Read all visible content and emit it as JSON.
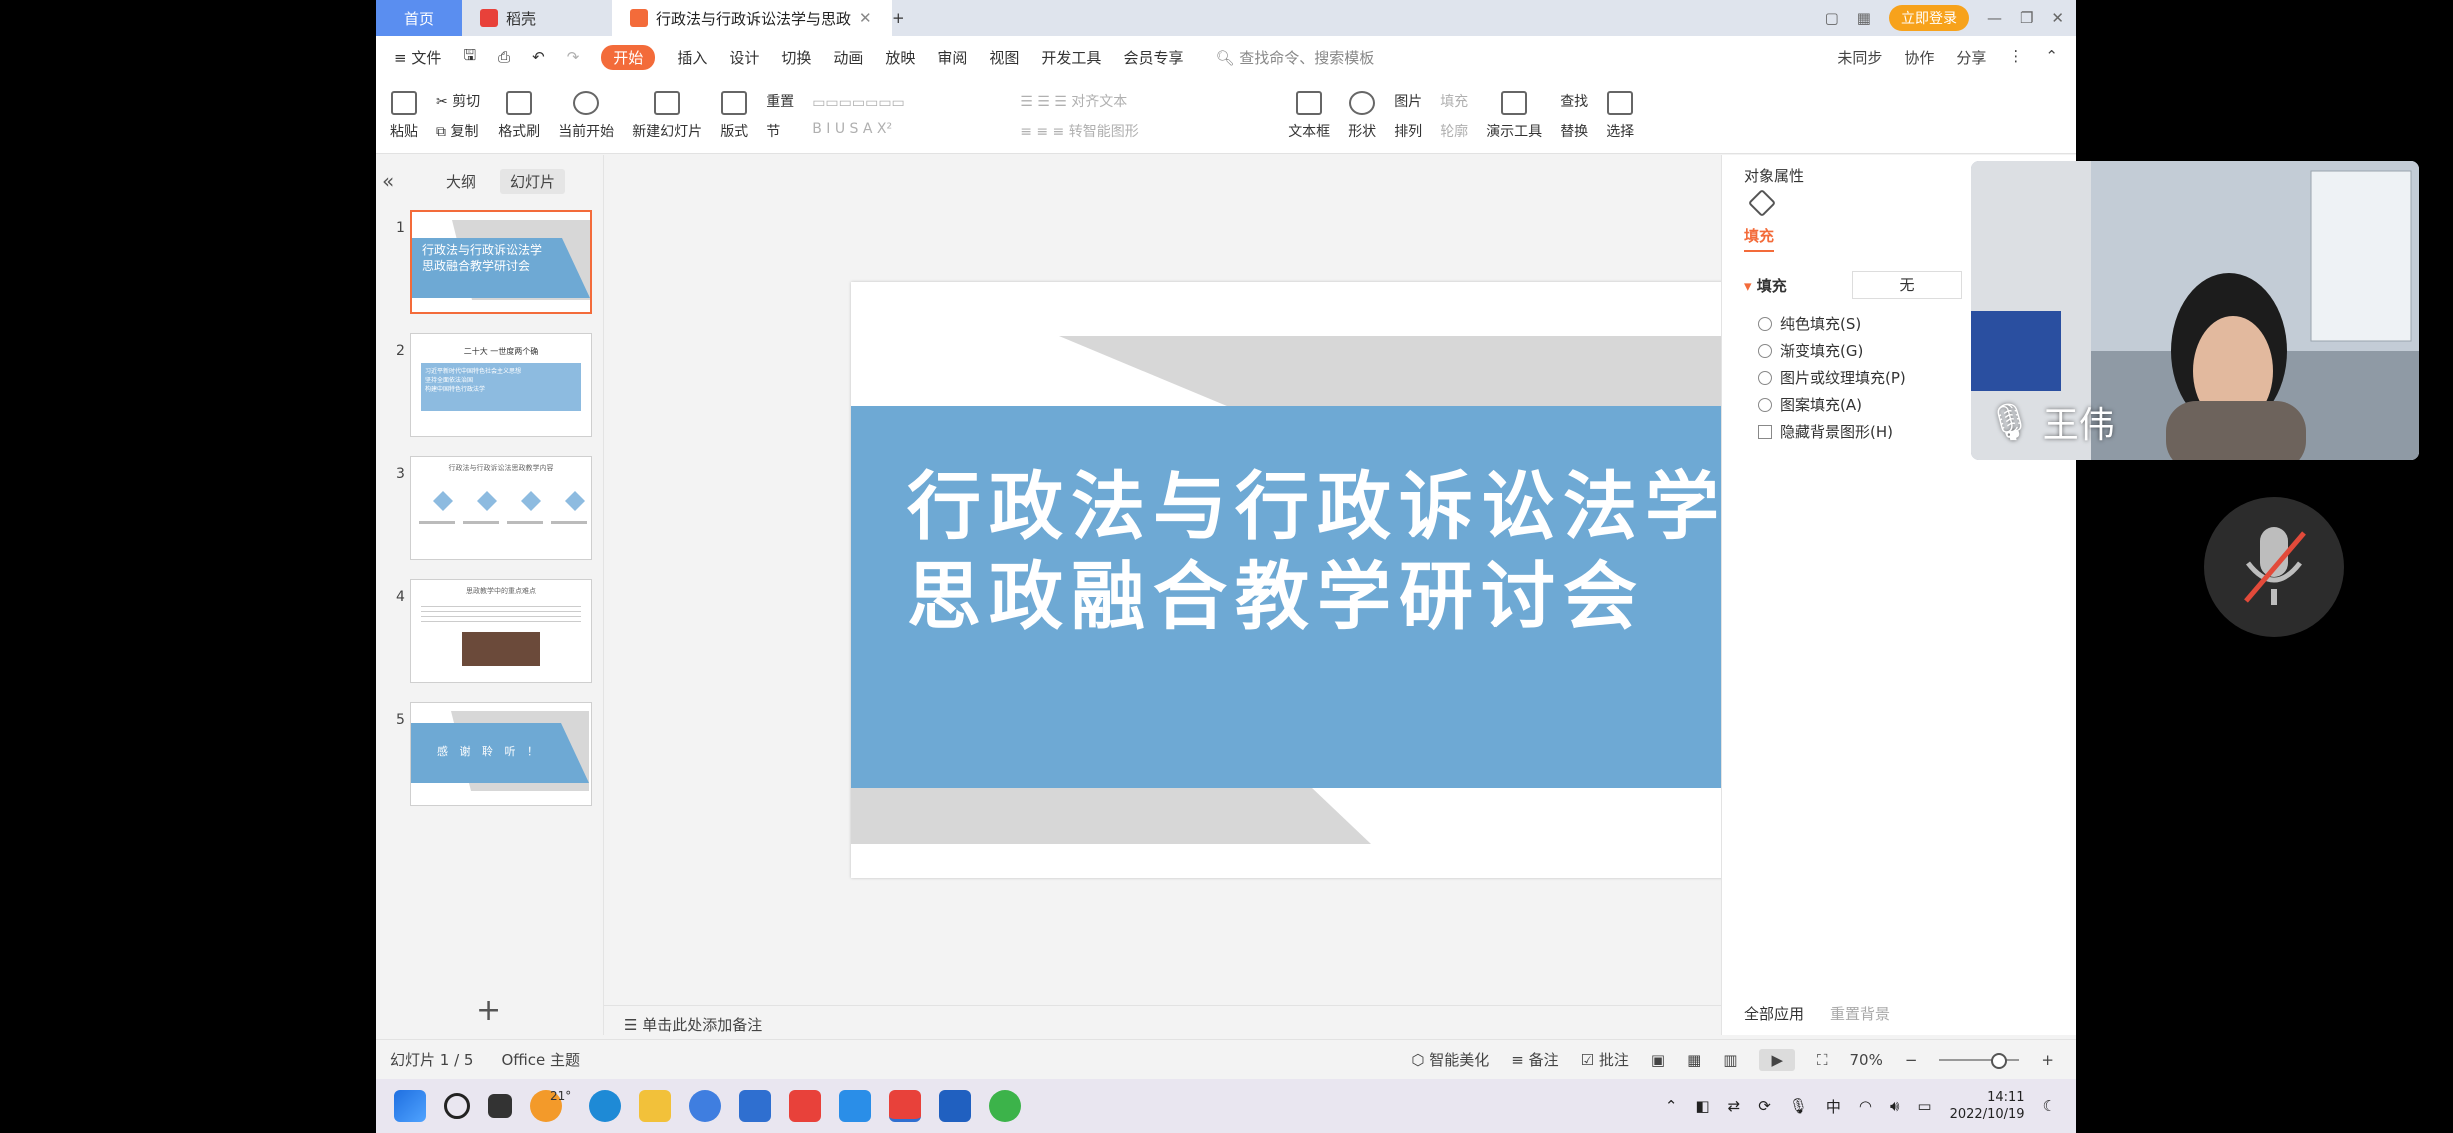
{
  "tabs": {
    "home": "首页",
    "docer": "稻壳",
    "active": "行政法与行政诉讼法学与思政"
  },
  "titlebar": {
    "login": "立即登录"
  },
  "menu": {
    "file": "≡ 文件",
    "items": [
      "开始",
      "插入",
      "设计",
      "切换",
      "动画",
      "放映",
      "审阅",
      "视图",
      "开发工具",
      "会员专享"
    ],
    "search": "查找命令、搜索模板",
    "right": [
      "未同步",
      "协作",
      "分享"
    ]
  },
  "ribbon": {
    "paste": "粘贴",
    "cut": "剪切",
    "copy": "复制",
    "format_painter": "格式刷",
    "from_current": "当前开始",
    "new_slide": "新建幻灯片",
    "layout": "版式",
    "reset": "重置",
    "section": "节",
    "align_text": "对齐文本",
    "smart_graphic": "转智能图形",
    "textbox": "文本框",
    "shape": "形状",
    "picture": "图片",
    "fill": "填充",
    "arrange": "排列",
    "outline": "轮廓",
    "present_tools": "演示工具",
    "find": "查找",
    "replace": "替换",
    "select": "选择"
  },
  "left_panel": {
    "outline_tab": "大纲",
    "slides_tab": "幻灯片",
    "add": "+"
  },
  "thumbs": [
    {
      "num": "1",
      "title": "行政法与行政诉讼法学\n思政融合教学研讨会"
    },
    {
      "num": "2",
      "title": "二十大 一世度两个确",
      "lines": [
        "习近平新时代中国特色社会主义思想",
        "坚持全面依法治国",
        "构建中国特色行政法学"
      ]
    },
    {
      "num": "3",
      "title": "行政法与行政诉讼法思政教学内容"
    },
    {
      "num": "4",
      "title": "思政教学中的重点难点"
    },
    {
      "num": "5",
      "title": "感 谢 聆 听 ！"
    }
  ],
  "slide": {
    "title_line1": "行政法与行政诉讼法学",
    "title_line2": "思政融合教学研讨会"
  },
  "notes": {
    "placeholder": "单击此处添加备注"
  },
  "right_panel": {
    "title": "对象属性",
    "fill_tab": "填充",
    "section": "填充",
    "none": "无",
    "options": [
      "纯色填充(S)",
      "渐变填充(G)",
      "图片或纹理填充(P)",
      "图案填充(A)"
    ],
    "hide_bg": "隐藏背景图形(H)",
    "apply_all": "全部应用",
    "reset_bg": "重置背景"
  },
  "status": {
    "slide_count": "幻灯片 1 / 5",
    "theme": "Office 主题",
    "beautify": "智能美化",
    "notes": "备注",
    "comments": "批注",
    "zoom": "70%"
  },
  "taskbar": {
    "weather": "21°",
    "ime": "中",
    "time": "14:11",
    "date": "2022/10/19"
  },
  "video": {
    "name": "王伟"
  },
  "colors": {
    "accent": "#f36b3a",
    "slide_blue": "#6ea9d4",
    "slide_gray": "#d7d7d7"
  }
}
